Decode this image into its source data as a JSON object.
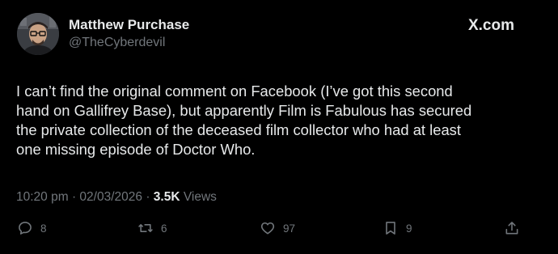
{
  "author": {
    "display_name": "Matthew Purchase",
    "handle": "@TheCyberdevil"
  },
  "brand": {
    "label": "X.com",
    "icon": "x-logo-icon"
  },
  "tweet": {
    "lines": [
      "I can’t find the original comment on Facebook (I’ve got this second",
      "hand on Gallifrey Base), but apparently Film is Fabulous has secured",
      "the private collection of the deceased film collector who had at least",
      "one missing episode of Doctor Who."
    ]
  },
  "meta": {
    "time": "10:20 pm",
    "separator": "·",
    "date": "02/03/2026",
    "views_count": "3.5K",
    "views_label": "Views"
  },
  "actions": {
    "reply_count": "8",
    "repost_count": "6",
    "like_count": "97",
    "bookmark_count": "9"
  },
  "colors": {
    "background": "#000000",
    "primary_text": "#e7e9ea",
    "secondary_text": "#71767b"
  }
}
